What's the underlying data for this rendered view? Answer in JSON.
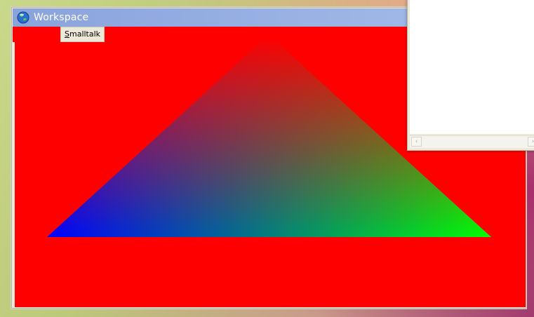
{
  "workspace_window": {
    "title": "Workspace",
    "icon": "smalltalk-globe-icon",
    "menu": {
      "items": [
        {
          "label": "Smalltalk",
          "mnemonic": "S",
          "rest": "malltalk"
        }
      ]
    },
    "canvas": {
      "background_color": "#ff0000",
      "shape": "gradient-triangle",
      "vertex_colors": {
        "top": "#ff0000",
        "bottom_left": "#0000ff",
        "bottom_right": "#00ff00"
      }
    }
  },
  "other_window": {
    "content_background": "#ffffff",
    "scrollbar": {
      "left_arrow_icon": "chevron-left-icon",
      "right_arrow_icon": "chevron-right-icon"
    }
  }
}
